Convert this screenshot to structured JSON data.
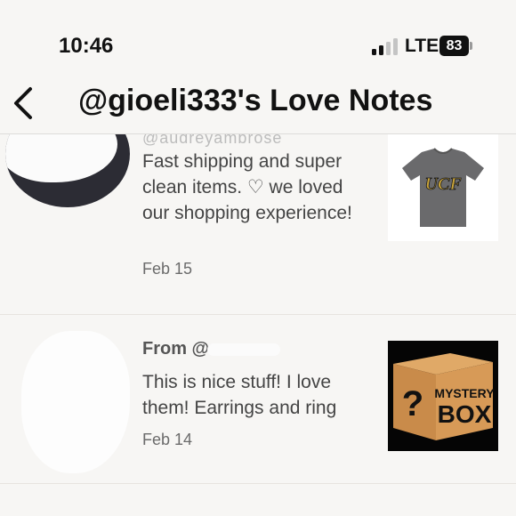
{
  "status_bar": {
    "time": "10:46",
    "network": "LTE",
    "battery": "83"
  },
  "header": {
    "title": "@gioeli333's Love Notes"
  },
  "notes": [
    {
      "username_partial": "@audreyambrose",
      "text": "Fast shipping and super clean items. ♡ we loved our shopping experience!",
      "date": "Feb 15",
      "item_image": "gray UCF t-shirt"
    },
    {
      "from_label": "From @u",
      "text": "This is nice stuff! I love them! Earrings and ring",
      "date": "Feb 14",
      "item_image": "mystery box"
    }
  ],
  "mystery_box_label": {
    "line1": "MYSTERY",
    "line2": "BOX",
    "mark": "?"
  },
  "tshirt_logo": "UCF"
}
